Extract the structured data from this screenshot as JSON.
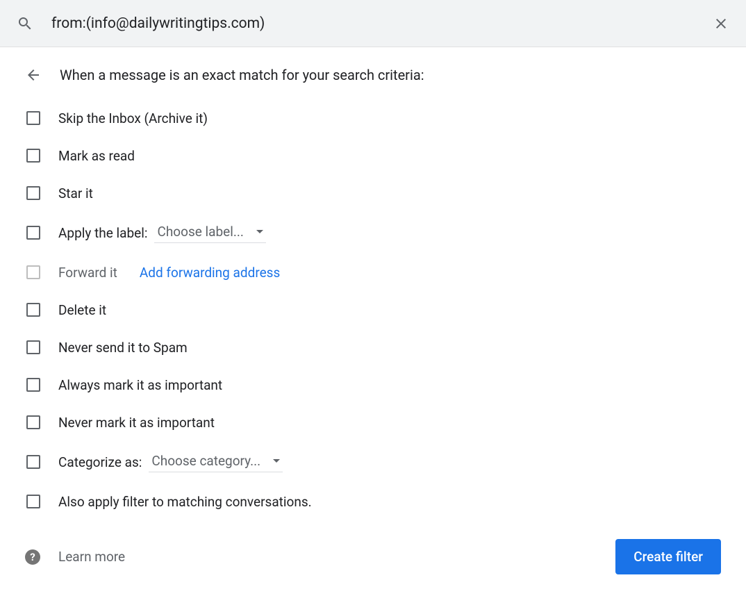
{
  "search": {
    "value": "from:(info@dailywritingtips.com)"
  },
  "header": {
    "title": "When a message is an exact match for your search criteria:"
  },
  "options": {
    "skip_inbox": "Skip the Inbox (Archive it)",
    "mark_read": "Mark as read",
    "star": "Star it",
    "apply_label": "Apply the label:",
    "label_dropdown": "Choose label...",
    "forward": "Forward it",
    "forward_link": "Add forwarding address",
    "delete": "Delete it",
    "never_spam": "Never send it to Spam",
    "always_important": "Always mark it as important",
    "never_important": "Never mark it as important",
    "categorize": "Categorize as:",
    "category_dropdown": "Choose category...",
    "also_apply": "Also apply filter to matching conversations."
  },
  "footer": {
    "learn_more": "Learn more",
    "create_button": "Create filter"
  }
}
